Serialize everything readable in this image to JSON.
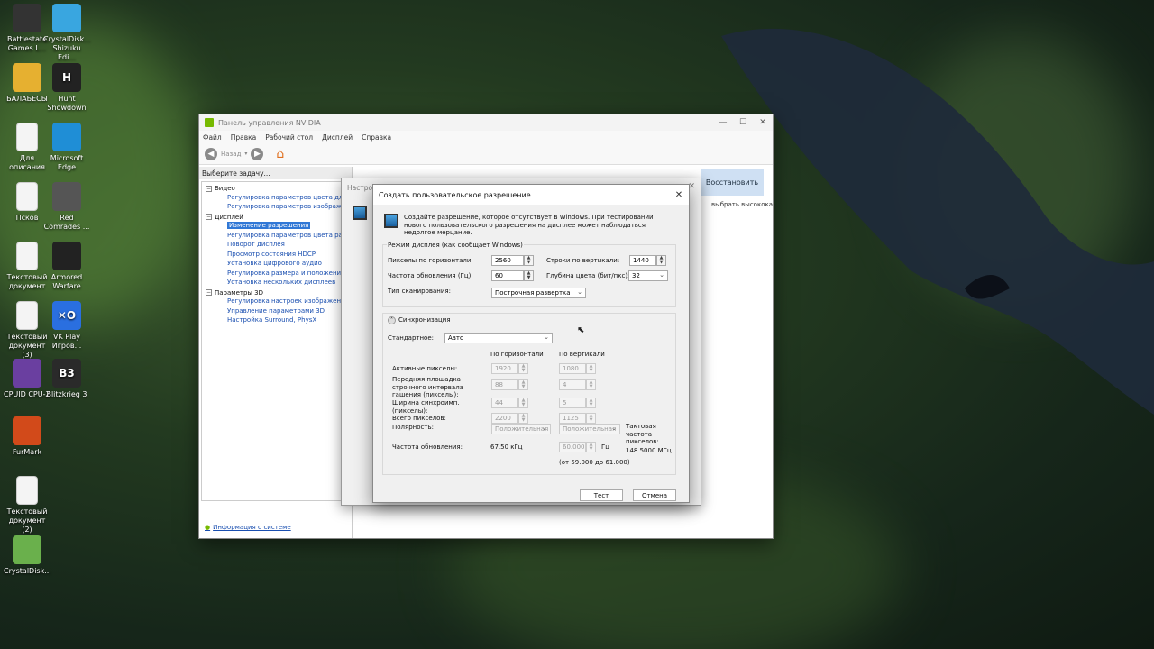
{
  "desktop_icons": [
    {
      "label": "Battlestate Games L...",
      "color": "#333"
    },
    {
      "label": "CrystalDisk... Shizuku Edi...",
      "color": "#39a6e0"
    },
    {
      "label": "БАЛАБЕСЫ",
      "color": "#e6b030"
    },
    {
      "label": "Hunt Showdown",
      "color": "#222"
    },
    {
      "label": "Для описания",
      "color": "doc"
    },
    {
      "label": "Microsoft Edge",
      "color": "#1f8ed6"
    },
    {
      "label": "Псков",
      "color": "doc"
    },
    {
      "label": "Red Comrades ...",
      "color": "#555"
    },
    {
      "label": "Текстовый документ",
      "color": "doc"
    },
    {
      "label": "Armored Warfare",
      "color": "#222"
    },
    {
      "label": "Текстовый документ (3)",
      "color": "doc"
    },
    {
      "label": "VK Play Игров...",
      "color": "#2a6fe0"
    },
    {
      "label": "CPUID CPU-Z",
      "color": "#6a3fa0"
    },
    {
      "label": "Blitzkrieg 3",
      "color": "#2a2a2a"
    },
    {
      "label": "FurMark",
      "color": "#d24a1a"
    },
    {
      "label": "Текстовый документ (2)",
      "color": "doc"
    },
    {
      "label": "CrystalDisk...",
      "color": "#6ab04c"
    }
  ],
  "icon_glyphs": {
    "hunt": "H",
    "vk": "✕O",
    "blitz": "B3"
  },
  "nvidia": {
    "title": "Панель управления NVIDIA",
    "menu": [
      "Файл",
      "Правка",
      "Рабочий стол",
      "Дисплей",
      "Справка"
    ],
    "back_label": "Назад",
    "task_header": "Выберите задачу...",
    "categories": [
      {
        "name": "Видео",
        "items": [
          "Регулировка параметров цвета для ви...",
          "Регулировка параметров изображени..."
        ]
      },
      {
        "name": "Дисплей",
        "items": [
          "Изменение разрешения",
          "Регулировка параметров цвета рабоч...",
          "Поворот дисплея",
          "Просмотр состояния HDCP",
          "Установка цифрового аудио",
          "Регулировка размера и положения ра...",
          "Установка нескольких дисплеев"
        ]
      },
      {
        "name": "Параметры 3D",
        "items": [
          "Регулировка настроек изображения с...",
          "Управление параметрами 3D",
          "Настройка Surround, PhysX"
        ]
      }
    ],
    "selected_item": "Изменение разрешения",
    "system_info": "Информация о системе",
    "restore_label": "Восстановить",
    "side_text": "выбрать высокока"
  },
  "bg_dialog_title": "Настрой",
  "dialog": {
    "title": "Создать пользовательское разрешение",
    "intro": "Создайте разрешение, которое отсутствует в Windows. При тестировании нового пользовательского разрешения на дисплее может наблюдаться недолгое мерцание.",
    "mode_group": "Режим дисплея (как сообщает Windows)",
    "h_pixels_label": "Пикселы по горизонтали:",
    "h_pixels": "2560",
    "v_lines_label": "Строки по вертикали:",
    "v_lines": "1440",
    "refresh_label": "Частота обновления (Гц):",
    "refresh": "60",
    "depth_label": "Глубина цвета (бит/пкс):",
    "depth": "32",
    "scan_label": "Тип сканирования:",
    "scan": "Построчная развертка",
    "sync_label": "Синхронизация",
    "standard_label": "Стандартное:",
    "standard": "Авто",
    "col_h": "По горизонтали",
    "col_v": "По вертикали",
    "rows": [
      {
        "label": "Активные пикселы:",
        "h": "1920",
        "v": "1080"
      },
      {
        "label": "Передняя площадка строчного интервала гашения (пикселы):",
        "h": "88",
        "v": "4"
      },
      {
        "label": "Ширина синхроимп. (пикселы):",
        "h": "44",
        "v": "5"
      },
      {
        "label": "Всего пикселов:",
        "h": "2200",
        "v": "1125"
      }
    ],
    "polarity_label": "Полярность:",
    "polarity_h": "Положительная",
    "polarity_v": "Положительная",
    "pixel_clock_label": "Тактовая частота пикселов:",
    "pixel_clock": "148.5000 МГц",
    "rate_label": "Частота обновления:",
    "rate_h": "67.50 кГц",
    "rate_v": "60.000",
    "rate_unit": "Гц",
    "rate_range": "(от 59.000 до 61.000)",
    "test_label": "Тест",
    "cancel_label": "Отмена"
  }
}
